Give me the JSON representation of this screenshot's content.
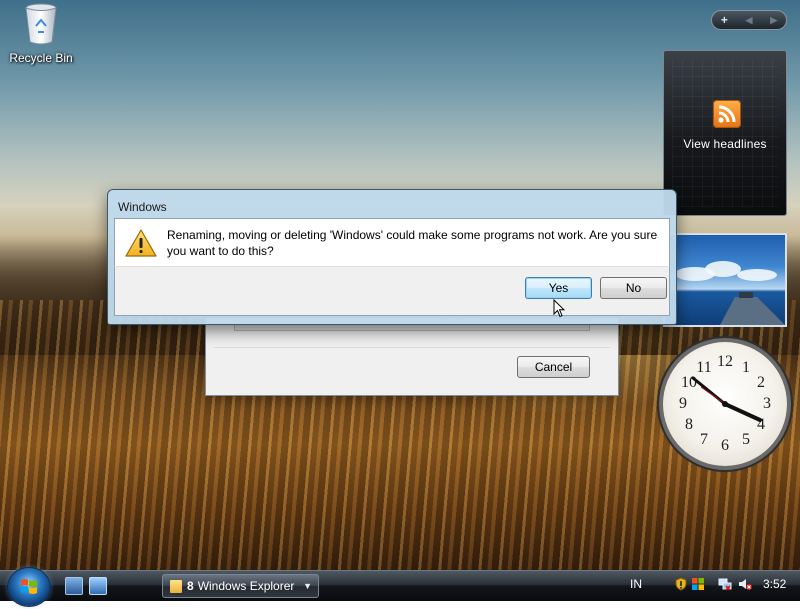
{
  "desktop": {
    "icons": [
      {
        "label": "Recycle Bin",
        "icon": "recycle-bin-icon"
      }
    ]
  },
  "sidebar": {
    "controls": {
      "add": "+",
      "prev": "◀",
      "next": "▶"
    },
    "feed_gadget": {
      "label": "View headlines",
      "icon": "rss-icon",
      "accent": "#f08a24"
    },
    "clock_gadget": {
      "numbers": [
        "12",
        "1",
        "2",
        "3",
        "4",
        "5",
        "6",
        "7",
        "8",
        "9",
        "10",
        "11"
      ]
    }
  },
  "back_dialog": {
    "cancel_label": "Cancel"
  },
  "dialog": {
    "title": "Windows",
    "icon": "warning-icon",
    "message": "Renaming, moving or deleting 'Windows' could make some programs not work. Are you sure you want to do this?",
    "yes_label": "Yes",
    "no_label": "No"
  },
  "taskbar": {
    "start": "windows-start-orb-icon",
    "quick_launch": [
      "show-desktop-icon",
      "switch-windows-icon"
    ],
    "task_button": {
      "count": "8",
      "label": "Windows Explorer",
      "icon": "folder-icon"
    },
    "language": "IN",
    "tray_icons": [
      "security-warning-icon",
      "windows-update-icon",
      "network-icon",
      "volume-muted-icon"
    ],
    "time": "3:52"
  }
}
